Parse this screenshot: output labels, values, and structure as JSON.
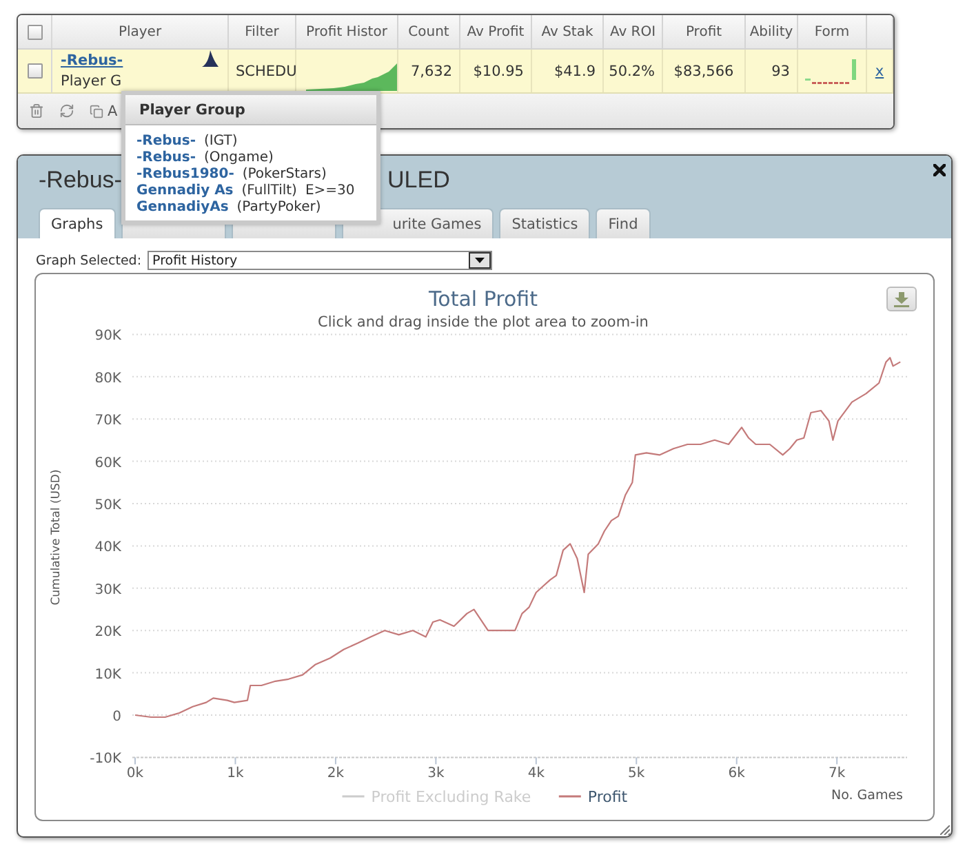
{
  "grid": {
    "select_all": {
      "checked": false
    },
    "columns": [
      "Player",
      "Filter",
      "Profit Histor",
      "Count",
      "Av Profit",
      "Av Stak",
      "Av ROI",
      "Profit",
      "Ability",
      "Form"
    ],
    "rows": [
      {
        "checked": false,
        "player": "-Rebus-",
        "group": "Player G",
        "filter": "SCHEDU",
        "count": "7,632",
        "av_profit": "$10.95",
        "av_stake": "$41.9",
        "av_roi": "50.2%",
        "profit": "$83,566",
        "ability": "93",
        "remove": "x"
      }
    ],
    "toolbar": {
      "button_label": "A"
    }
  },
  "tooltip": {
    "title": "Player Group",
    "members": [
      {
        "name": "-Rebus-",
        "site": "(IGT)"
      },
      {
        "name": "-Rebus-",
        "site": "(Ongame)"
      },
      {
        "name": "-Rebus1980-",
        "site": "(PokerStars)"
      },
      {
        "name": "Gennadiy As",
        "site": "(FullTilt)",
        "note": "E>=30"
      },
      {
        "name": "GennadiyAs",
        "site": "(PartyPoker)"
      }
    ]
  },
  "dialog": {
    "title": "-Rebus-",
    "title_end": "ULED",
    "tabs": [
      {
        "label": "Graphs",
        "selected": true
      },
      {
        "selected": false
      },
      {
        "selected": false
      },
      {
        "label": "urite Games",
        "selected": false
      },
      {
        "label": "Statistics",
        "selected": false
      },
      {
        "label": "Find",
        "selected": false
      }
    ],
    "graph_select": {
      "label": "Graph Selected:",
      "value": "Profit History"
    },
    "chart": {
      "subtitle": "Click and drag inside the plot area to zoom-in",
      "chart_data": {
        "type": "line",
        "title": "Total Profit",
        "xlabel": "No. Games",
        "ylabel": "Cumulative Total (USD)",
        "grid": true,
        "x": [
          0,
          160,
          300,
          440,
          575,
          710,
          780,
          920,
          990,
          1120,
          1150,
          1260,
          1400,
          1530,
          1670,
          1800,
          1945,
          2080,
          2220,
          2350,
          2490,
          2630,
          2770,
          2900,
          2970,
          3040,
          3180,
          3310,
          3380,
          3450,
          3520,
          3660,
          3790,
          3860,
          3930,
          4000,
          4070,
          4140,
          4200,
          4270,
          4340,
          4410,
          4480,
          4520,
          4620,
          4680,
          4750,
          4820,
          4890,
          4960,
          4990,
          5100,
          5230,
          5370,
          5510,
          5640,
          5780,
          5920,
          6050,
          6120,
          6190,
          6330,
          6460,
          6530,
          6600,
          6670,
          6740,
          6840,
          6920,
          6960,
          7010,
          7150,
          7290,
          7420,
          7490,
          7530,
          7560,
          7632
        ],
        "series": [
          {
            "name": "Profit Excluding Rake",
            "color": "#cccccc",
            "values": [
              null,
              null,
              null,
              null,
              null,
              null,
              null,
              null,
              null,
              null,
              null,
              null,
              null,
              null,
              null,
              null,
              null,
              null,
              null,
              null,
              null,
              null,
              null,
              null,
              null,
              null,
              null,
              null,
              null,
              null,
              null,
              null,
              null,
              null,
              null,
              null,
              null,
              null,
              null,
              null,
              null,
              null,
              null,
              null,
              null,
              null,
              null,
              null,
              null,
              null,
              null,
              null,
              null,
              null,
              null,
              null,
              null,
              null,
              null,
              null,
              null,
              null,
              null,
              null,
              null,
              null,
              null,
              null,
              null,
              null,
              null,
              null,
              null,
              null,
              null,
              null,
              null,
              null
            ]
          },
          {
            "name": "Profit",
            "color": "#c47a7a",
            "values": [
              0,
              -500,
              -500,
              500,
              2000,
              3000,
              4000,
              3500,
              3000,
              3500,
              7000,
              7000,
              8000,
              8500,
              9500,
              12000,
              13500,
              15500,
              17000,
              18500,
              20000,
              19000,
              20000,
              18500,
              22000,
              22500,
              21000,
              24000,
              25000,
              22500,
              20000,
              20000,
              20000,
              24000,
              25500,
              29000,
              30500,
              32000,
              33000,
              39000,
              40500,
              37000,
              29000,
              38000,
              40500,
              43500,
              46000,
              47000,
              52000,
              55000,
              61500,
              62000,
              61500,
              63000,
              64000,
              64000,
              65000,
              64000,
              68000,
              65500,
              64000,
              64000,
              61500,
              63000,
              65000,
              65500,
              71500,
              72000,
              69500,
              65000,
              69500,
              74000,
              76000,
              78500,
              83500,
              84500,
              82500,
              83500
            ]
          }
        ],
        "xlim": [
          0,
          7700
        ],
        "ylim": [
          -10000,
          90000
        ],
        "xticks": [
          {
            "value": 0,
            "label": "0k"
          },
          {
            "value": 1000,
            "label": "1k"
          },
          {
            "value": 2000,
            "label": "2k"
          },
          {
            "value": 3000,
            "label": "3k"
          },
          {
            "value": 4000,
            "label": "4k"
          },
          {
            "value": 5000,
            "label": "5k"
          },
          {
            "value": 6000,
            "label": "6k"
          },
          {
            "value": 7000,
            "label": "7k"
          }
        ],
        "yticks": [
          {
            "value": -10000,
            "label": "-10K"
          },
          {
            "value": 0,
            "label": "0"
          },
          {
            "value": 10000,
            "label": "10K"
          },
          {
            "value": 20000,
            "label": "20K"
          },
          {
            "value": 30000,
            "label": "30K"
          },
          {
            "value": 40000,
            "label": "40K"
          },
          {
            "value": 50000,
            "label": "50K"
          },
          {
            "value": 60000,
            "label": "60K"
          },
          {
            "value": 70000,
            "label": "70K"
          },
          {
            "value": 80000,
            "label": "80K"
          },
          {
            "value": 90000,
            "label": "90K"
          }
        ]
      }
    }
  }
}
